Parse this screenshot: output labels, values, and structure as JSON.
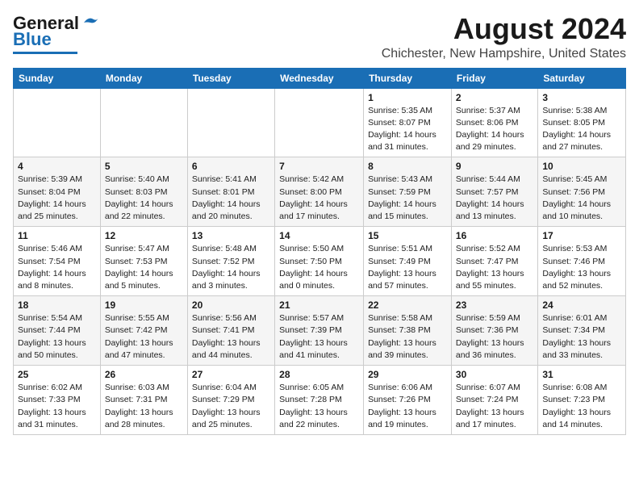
{
  "logo": {
    "general": "General",
    "blue": "Blue"
  },
  "header": {
    "month": "August 2024",
    "location": "Chichester, New Hampshire, United States"
  },
  "days_of_week": [
    "Sunday",
    "Monday",
    "Tuesday",
    "Wednesday",
    "Thursday",
    "Friday",
    "Saturday"
  ],
  "weeks": [
    [
      {
        "day": "",
        "info": ""
      },
      {
        "day": "",
        "info": ""
      },
      {
        "day": "",
        "info": ""
      },
      {
        "day": "",
        "info": ""
      },
      {
        "day": "1",
        "info": "Sunrise: 5:35 AM\nSunset: 8:07 PM\nDaylight: 14 hours\nand 31 minutes."
      },
      {
        "day": "2",
        "info": "Sunrise: 5:37 AM\nSunset: 8:06 PM\nDaylight: 14 hours\nand 29 minutes."
      },
      {
        "day": "3",
        "info": "Sunrise: 5:38 AM\nSunset: 8:05 PM\nDaylight: 14 hours\nand 27 minutes."
      }
    ],
    [
      {
        "day": "4",
        "info": "Sunrise: 5:39 AM\nSunset: 8:04 PM\nDaylight: 14 hours\nand 25 minutes."
      },
      {
        "day": "5",
        "info": "Sunrise: 5:40 AM\nSunset: 8:03 PM\nDaylight: 14 hours\nand 22 minutes."
      },
      {
        "day": "6",
        "info": "Sunrise: 5:41 AM\nSunset: 8:01 PM\nDaylight: 14 hours\nand 20 minutes."
      },
      {
        "day": "7",
        "info": "Sunrise: 5:42 AM\nSunset: 8:00 PM\nDaylight: 14 hours\nand 17 minutes."
      },
      {
        "day": "8",
        "info": "Sunrise: 5:43 AM\nSunset: 7:59 PM\nDaylight: 14 hours\nand 15 minutes."
      },
      {
        "day": "9",
        "info": "Sunrise: 5:44 AM\nSunset: 7:57 PM\nDaylight: 14 hours\nand 13 minutes."
      },
      {
        "day": "10",
        "info": "Sunrise: 5:45 AM\nSunset: 7:56 PM\nDaylight: 14 hours\nand 10 minutes."
      }
    ],
    [
      {
        "day": "11",
        "info": "Sunrise: 5:46 AM\nSunset: 7:54 PM\nDaylight: 14 hours\nand 8 minutes."
      },
      {
        "day": "12",
        "info": "Sunrise: 5:47 AM\nSunset: 7:53 PM\nDaylight: 14 hours\nand 5 minutes."
      },
      {
        "day": "13",
        "info": "Sunrise: 5:48 AM\nSunset: 7:52 PM\nDaylight: 14 hours\nand 3 minutes."
      },
      {
        "day": "14",
        "info": "Sunrise: 5:50 AM\nSunset: 7:50 PM\nDaylight: 14 hours\nand 0 minutes."
      },
      {
        "day": "15",
        "info": "Sunrise: 5:51 AM\nSunset: 7:49 PM\nDaylight: 13 hours\nand 57 minutes."
      },
      {
        "day": "16",
        "info": "Sunrise: 5:52 AM\nSunset: 7:47 PM\nDaylight: 13 hours\nand 55 minutes."
      },
      {
        "day": "17",
        "info": "Sunrise: 5:53 AM\nSunset: 7:46 PM\nDaylight: 13 hours\nand 52 minutes."
      }
    ],
    [
      {
        "day": "18",
        "info": "Sunrise: 5:54 AM\nSunset: 7:44 PM\nDaylight: 13 hours\nand 50 minutes."
      },
      {
        "day": "19",
        "info": "Sunrise: 5:55 AM\nSunset: 7:42 PM\nDaylight: 13 hours\nand 47 minutes."
      },
      {
        "day": "20",
        "info": "Sunrise: 5:56 AM\nSunset: 7:41 PM\nDaylight: 13 hours\nand 44 minutes."
      },
      {
        "day": "21",
        "info": "Sunrise: 5:57 AM\nSunset: 7:39 PM\nDaylight: 13 hours\nand 41 minutes."
      },
      {
        "day": "22",
        "info": "Sunrise: 5:58 AM\nSunset: 7:38 PM\nDaylight: 13 hours\nand 39 minutes."
      },
      {
        "day": "23",
        "info": "Sunrise: 5:59 AM\nSunset: 7:36 PM\nDaylight: 13 hours\nand 36 minutes."
      },
      {
        "day": "24",
        "info": "Sunrise: 6:01 AM\nSunset: 7:34 PM\nDaylight: 13 hours\nand 33 minutes."
      }
    ],
    [
      {
        "day": "25",
        "info": "Sunrise: 6:02 AM\nSunset: 7:33 PM\nDaylight: 13 hours\nand 31 minutes."
      },
      {
        "day": "26",
        "info": "Sunrise: 6:03 AM\nSunset: 7:31 PM\nDaylight: 13 hours\nand 28 minutes."
      },
      {
        "day": "27",
        "info": "Sunrise: 6:04 AM\nSunset: 7:29 PM\nDaylight: 13 hours\nand 25 minutes."
      },
      {
        "day": "28",
        "info": "Sunrise: 6:05 AM\nSunset: 7:28 PM\nDaylight: 13 hours\nand 22 minutes."
      },
      {
        "day": "29",
        "info": "Sunrise: 6:06 AM\nSunset: 7:26 PM\nDaylight: 13 hours\nand 19 minutes."
      },
      {
        "day": "30",
        "info": "Sunrise: 6:07 AM\nSunset: 7:24 PM\nDaylight: 13 hours\nand 17 minutes."
      },
      {
        "day": "31",
        "info": "Sunrise: 6:08 AM\nSunset: 7:23 PM\nDaylight: 13 hours\nand 14 minutes."
      }
    ]
  ]
}
